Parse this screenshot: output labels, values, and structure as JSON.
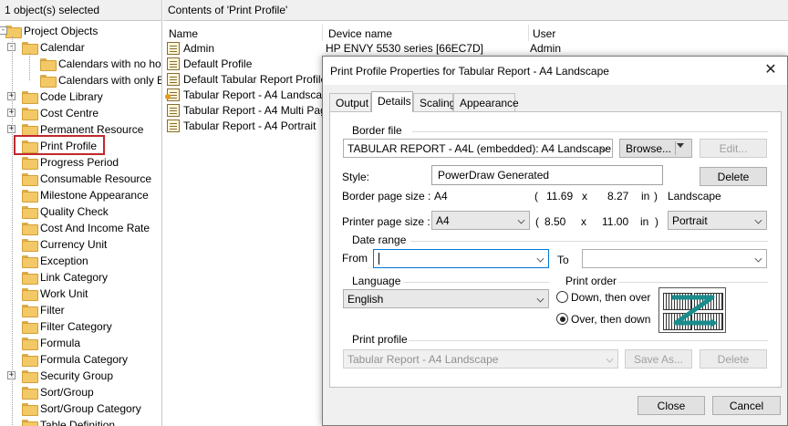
{
  "left_pane": {
    "header": "1 object(s) selected",
    "tree": [
      {
        "label": "Project Objects",
        "level": 0,
        "expander": "-"
      },
      {
        "label": "Calendar",
        "level": 1,
        "expander": "-"
      },
      {
        "label": "Calendars with no ho",
        "level": 2,
        "expander": ""
      },
      {
        "label": "Calendars with only E",
        "level": 2,
        "expander": ""
      },
      {
        "label": "Code Library",
        "level": 1,
        "expander": "+"
      },
      {
        "label": "Cost Centre",
        "level": 1,
        "expander": "+"
      },
      {
        "label": "Permanent Resource",
        "level": 1,
        "expander": "+"
      },
      {
        "label": "Print Profile",
        "level": 1,
        "expander": ""
      },
      {
        "label": "Progress Period",
        "level": 1,
        "expander": ""
      },
      {
        "label": "Consumable Resource",
        "level": 1,
        "expander": ""
      },
      {
        "label": "Milestone Appearance",
        "level": 1,
        "expander": ""
      },
      {
        "label": "Quality Check",
        "level": 1,
        "expander": ""
      },
      {
        "label": "Cost And Income Rate",
        "level": 1,
        "expander": ""
      },
      {
        "label": "Currency Unit",
        "level": 1,
        "expander": ""
      },
      {
        "label": "Exception",
        "level": 1,
        "expander": ""
      },
      {
        "label": "Link Category",
        "level": 1,
        "expander": ""
      },
      {
        "label": "Work Unit",
        "level": 1,
        "expander": ""
      },
      {
        "label": "Filter",
        "level": 1,
        "expander": ""
      },
      {
        "label": "Filter Category",
        "level": 1,
        "expander": ""
      },
      {
        "label": "Formula",
        "level": 1,
        "expander": ""
      },
      {
        "label": "Formula Category",
        "level": 1,
        "expander": ""
      },
      {
        "label": "Security Group",
        "level": 1,
        "expander": "+"
      },
      {
        "label": "Sort/Group",
        "level": 1,
        "expander": ""
      },
      {
        "label": "Sort/Group Category",
        "level": 1,
        "expander": ""
      },
      {
        "label": "Table Definition",
        "level": 1,
        "expander": ""
      }
    ]
  },
  "right_pane": {
    "header": "Contents of 'Print Profile'",
    "columns": [
      "Name",
      "Device name",
      "User"
    ],
    "rows": [
      {
        "name": "Admin",
        "device": "HP ENVY 5530 series [66EC7D]",
        "user": "Admin"
      },
      {
        "name": "Default Profile",
        "device": "",
        "user": ""
      },
      {
        "name": "Default Tabular Report Profile",
        "device": "",
        "user": ""
      },
      {
        "name": "Tabular Report - A4 Landscape",
        "device": "",
        "user": ""
      },
      {
        "name": "Tabular Report - A4 Multi Page",
        "device": "",
        "user": ""
      },
      {
        "name": "Tabular Report - A4 Portrait",
        "device": "",
        "user": ""
      }
    ]
  },
  "dialog": {
    "title": "Print Profile Properties for Tabular Report - A4 Landscape",
    "close_glyph": "✕",
    "tabs": [
      "Output",
      "Details",
      "Scaling",
      "Appearance"
    ],
    "active_tab": "Details",
    "border_file": {
      "group_label": "Border file",
      "value": "TABULAR REPORT - A4L (embedded): A4 Landscape Pov",
      "browse_label": "Browse...",
      "edit_label": "Edit..."
    },
    "style": {
      "label": "Style:",
      "value": "PowerDraw Generated",
      "delete_label": "Delete"
    },
    "border_page_size": {
      "label": "Border page size :",
      "paper": "A4",
      "open": "(",
      "width": "11.69",
      "x": "x",
      "height": "8.27",
      "unit": "in",
      "close": ")",
      "orientation": "Landscape"
    },
    "printer_page_size": {
      "label": "Printer page size :",
      "paper": "A4",
      "open": "(",
      "width": "8.50",
      "x": "x",
      "height": "11.00",
      "unit": "in",
      "close": ")",
      "orientation": "Portrait"
    },
    "date_range": {
      "group_label": "Date range",
      "from_label": "From",
      "from_value": "",
      "to_label": "To",
      "to_value": ""
    },
    "language": {
      "group_label": "Language",
      "value": "English"
    },
    "print_order": {
      "group_label": "Print order",
      "options": [
        "Down, then over",
        "Over, then down"
      ],
      "selected": "Over, then down"
    },
    "print_profile": {
      "group_label": "Print profile",
      "value": "Tabular Report - A4 Landscape",
      "save_as_label": "Save As...",
      "delete_label": "Delete"
    },
    "buttons": {
      "close": "Close",
      "cancel": "Cancel"
    }
  }
}
